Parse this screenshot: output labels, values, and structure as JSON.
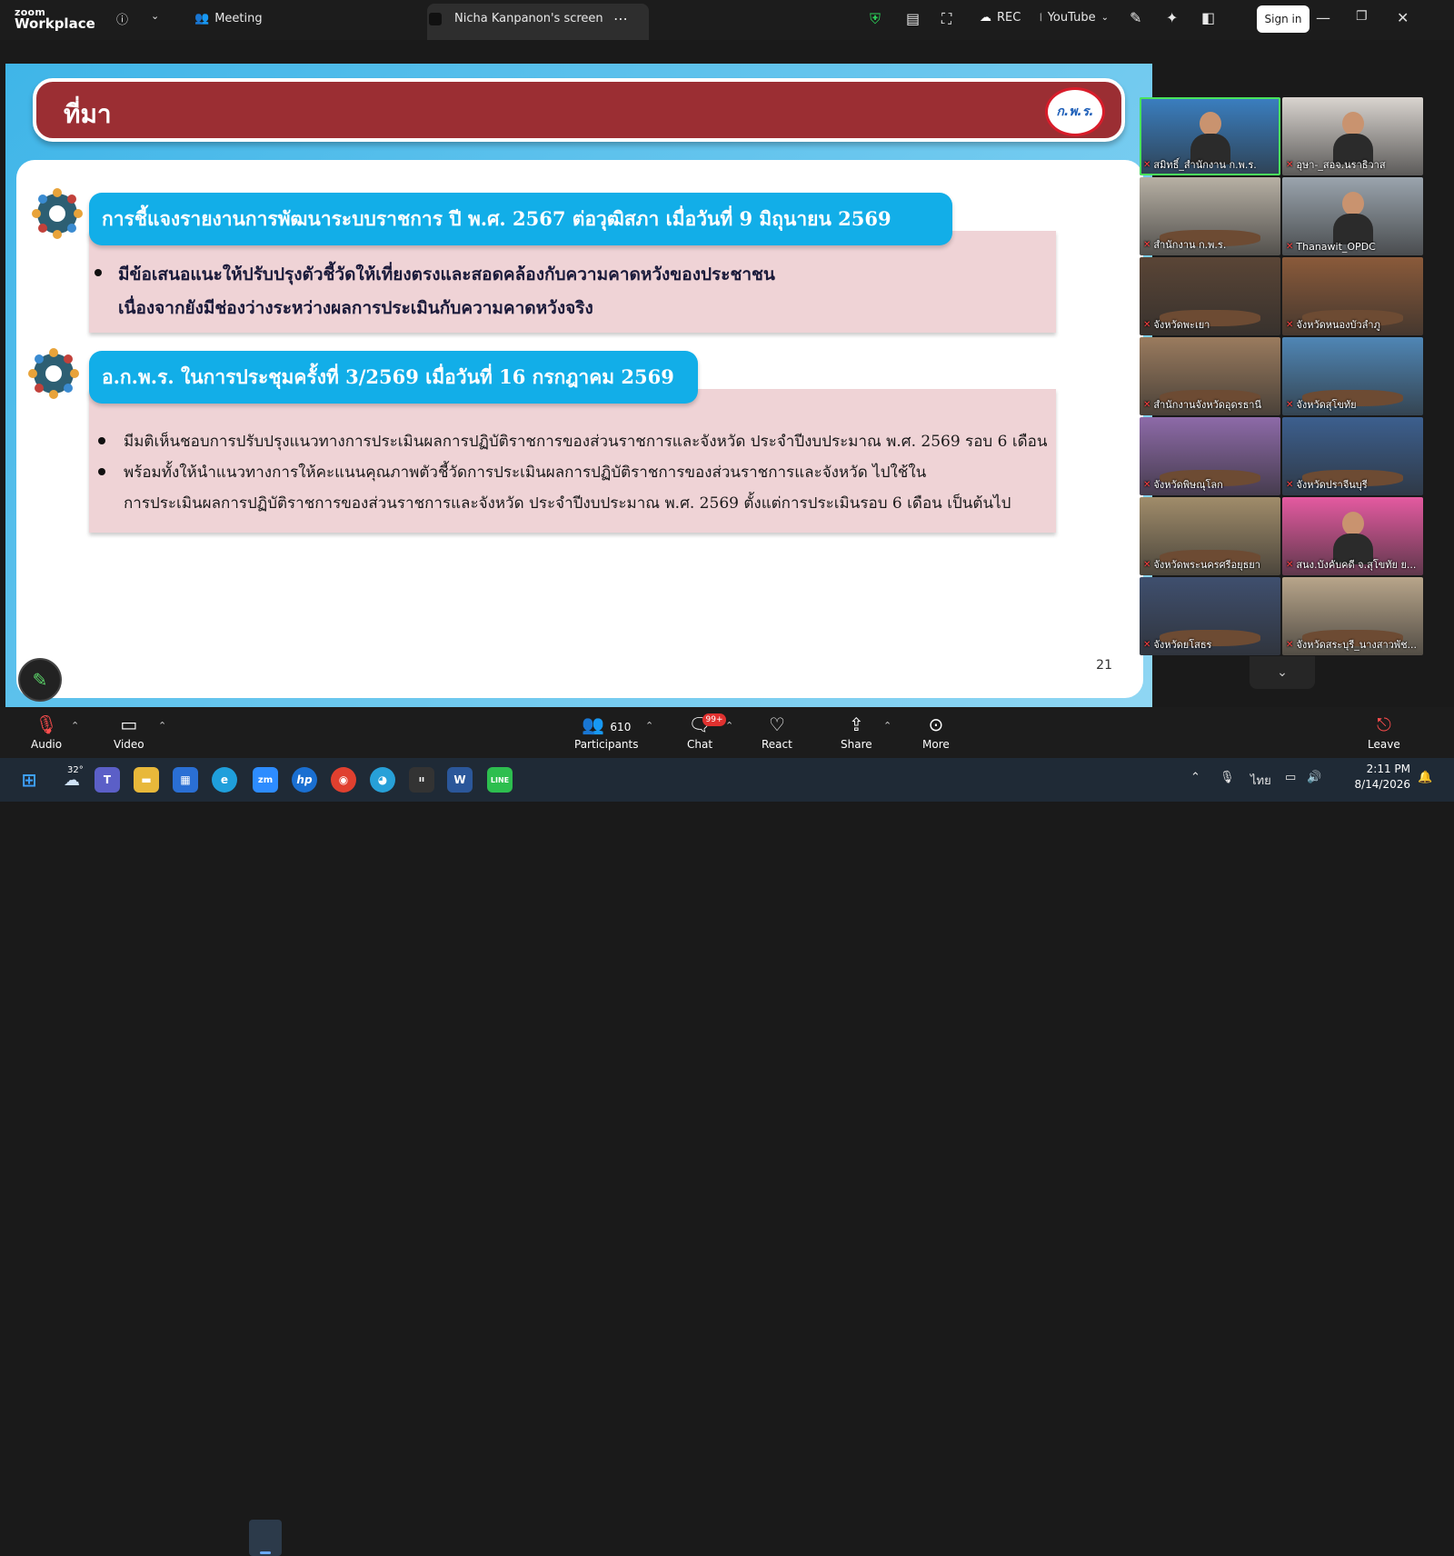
{
  "topbar": {
    "logo_line1": "zoom",
    "logo_line2": "Workplace",
    "meeting_label": "Meeting",
    "screen_tab_label": "Nicha Kanpanon's screen",
    "rec_label": "REC",
    "stream_label": "YouTube",
    "signin_label": "Sign in"
  },
  "slide": {
    "title": "ที่มา",
    "brand_text": "ก.พ.ร.",
    "topic1": "การชี้แจงรายงานการพัฒนาระบบราชการ ปี พ.ศ. 2567 ต่อวุฒิสภา เมื่อวันที่ 9 มิถุนายน 2569",
    "topic1_lines": [
      "มีข้อเสนอแนะให้ปรับปรุงตัวชี้วัดให้เที่ยงตรงและสอดคล้องกับความคาดหวังของประชาชน",
      "เนื่องจากยังมีช่องว่างระหว่างผลการประเมินกับความคาดหวังจริง"
    ],
    "topic2": "อ.ก.พ.ร. ในการประชุมครั้งที่ 3/2569 เมื่อวันที่ 16 กรกฎาคม 2569",
    "topic2_lines": [
      "มีมติเห็นชอบการปรับปรุงแนวทางการประเมินผลการปฏิบัติราชการของส่วนราชการและจังหวัด ประจำปีงบประมาณ พ.ศ. 2569 รอบ 6 เดือน",
      "พร้อมทั้งให้นำแนวทางการให้คะแนนคุณภาพตัวชี้วัดการประเมินผลการปฏิบัติราชการของส่วนราชการและจังหวัด ไปใช้ใน",
      "การประเมินผลการปฏิบัติราชการของส่วนราชการและจังหวัด ประจำปีงบประมาณ พ.ศ. 2569 ตั้งแต่การประเมินรอบ 6 เดือน เป็นต้นไป"
    ],
    "page_number": "21"
  },
  "gallery": [
    {
      "name": "สมิทธิ์_สำนักงาน ก.พ.ร.",
      "bg": "#3a7fc1",
      "kind": "person"
    },
    {
      "name": "อุษา-_สอจ.นราธิวาส",
      "bg": "#d9d4cf",
      "kind": "person"
    },
    {
      "name": "สำนักงาน ก.พ.ร.",
      "bg": "#b7b0a4",
      "kind": "room"
    },
    {
      "name": "Thanawit_OPDC",
      "bg": "#9aa4ad",
      "kind": "person"
    },
    {
      "name": "จังหวัดพะเยา",
      "bg": "#5a4536",
      "kind": "room"
    },
    {
      "name": "จังหวัดหนองบัวลำภู",
      "bg": "#8a5a3a",
      "kind": "room"
    },
    {
      "name": "สำนักงานจังหวัดอุดรธานี",
      "bg": "#9a7b5e",
      "kind": "room"
    },
    {
      "name": "จังหวัดสุโขทัย",
      "bg": "#4f86b5",
      "kind": "room"
    },
    {
      "name": "จังหวัดพิษณุโลก",
      "bg": "#8d6aa8",
      "kind": "room"
    },
    {
      "name": "จังหวัดปราจีนบุรี",
      "bg": "#3c5f8e",
      "kind": "room"
    },
    {
      "name": "จังหวัดพระนครศรีอยุธยา",
      "bg": "#a08c6a",
      "kind": "room"
    },
    {
      "name": "สนง.บังคับคดี จ.สุโขทัย ย...",
      "bg": "#e45aa0",
      "kind": "person"
    },
    {
      "name": "จังหวัดยโสธร",
      "bg": "#3f4f6e",
      "kind": "room"
    },
    {
      "name": "จังหวัดสระบุรี_นางสาวพัช...",
      "bg": "#b8a58a",
      "kind": "room"
    }
  ],
  "toolbar": {
    "audio": "Audio",
    "video": "Video",
    "participants": "Participants",
    "participants_count": "610",
    "chat": "Chat",
    "chat_badge": "99+",
    "react": "React",
    "share": "Share",
    "more": "More",
    "leave": "Leave"
  },
  "taskbar": {
    "temperature": "32°",
    "language": "ไทย",
    "time": "2:11 PM",
    "date": "8/14/2026"
  },
  "colors": {
    "header_red": "#9b2e33",
    "topic_blue": "#12aee8",
    "panel_pink": "#efd3d6",
    "active_speaker": "#4ae35c"
  }
}
